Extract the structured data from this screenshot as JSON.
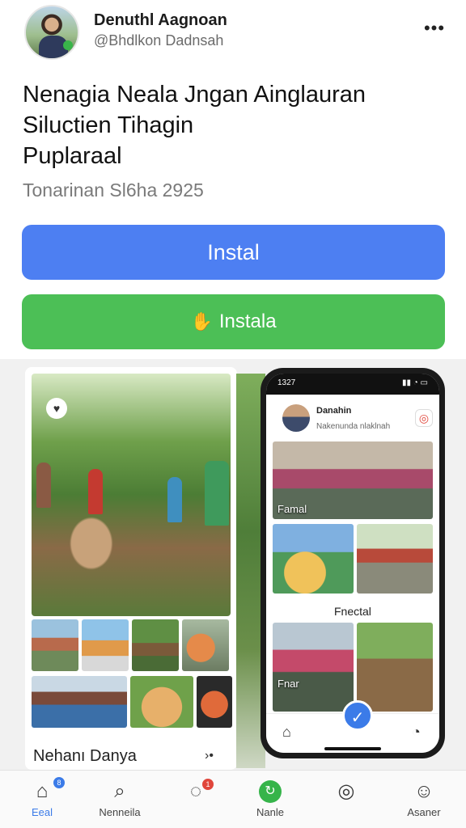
{
  "header": {
    "account_name": "Denuthl Aagnoan",
    "account_handle": "@Bhdlkon Dadnsah",
    "more_label": "•••"
  },
  "listing": {
    "title_line1": "Nenagia Neala Jngan Ainglauran",
    "title_line2": "Siluctien Tihagin",
    "title_line3": "Puplaraal",
    "subtitle": "Tonarinan Sl6ha 2925"
  },
  "buttons": {
    "primary_label": "Instal",
    "secondary_label": "Instala",
    "secondary_icon": "hand-icon"
  },
  "preview": {
    "caption": "Nehanı Danya",
    "caption_more": "›•",
    "phone": {
      "status_time": "1327",
      "status_icons": "▮▮ ◔ ▭",
      "profile_name": "Danahin",
      "profile_handle": "Nakenunda nlaklnah",
      "tile1_label": "Famal",
      "tile2_label": "Fnectal",
      "tile3_label": "Fnar"
    }
  },
  "bottom_nav": {
    "items": [
      {
        "label": "Eeal",
        "icon": "home-icon",
        "badge": "8"
      },
      {
        "label": "Nenneila",
        "icon": "search-icon"
      },
      {
        "label": "",
        "icon": "chat-icon",
        "badge": "1"
      },
      {
        "label": "Nanle",
        "icon": "update-icon"
      },
      {
        "label": "",
        "icon": "library-icon"
      },
      {
        "label": "Asaner",
        "icon": "profile-icon"
      }
    ]
  },
  "colors": {
    "primary_blue": "#4d7ff2",
    "install_green": "#4cbf56",
    "badge_blue": "#3b7be8",
    "badge_red": "#e0463b"
  }
}
